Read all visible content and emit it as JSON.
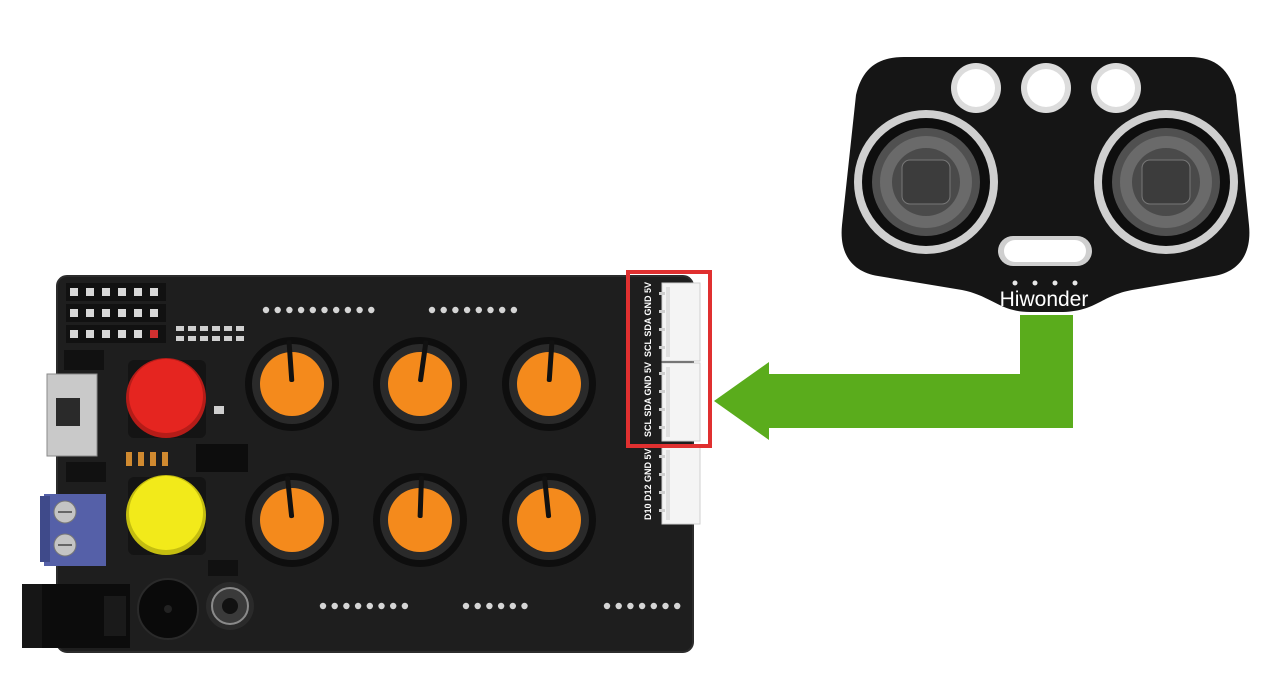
{
  "sensor": {
    "brand": "Hiwonder"
  },
  "board": {
    "connectors": [
      {
        "label": "SCL SDA GND 5V",
        "highlighted": true
      },
      {
        "label": "SCL SDA GND 5V",
        "highlighted": true
      },
      {
        "label": "D10 D12 GND 5V",
        "highlighted": false
      }
    ],
    "knobs": 6,
    "buttons": [
      "red",
      "yellow"
    ]
  },
  "colors": {
    "board": "#1e1e1e",
    "knob": "#f48a1c",
    "highlight": "#e03030",
    "arrow": "#5aac1c",
    "red_button": "#e52520",
    "yellow_button": "#f2ea1a",
    "terminal": "#5560a8"
  }
}
